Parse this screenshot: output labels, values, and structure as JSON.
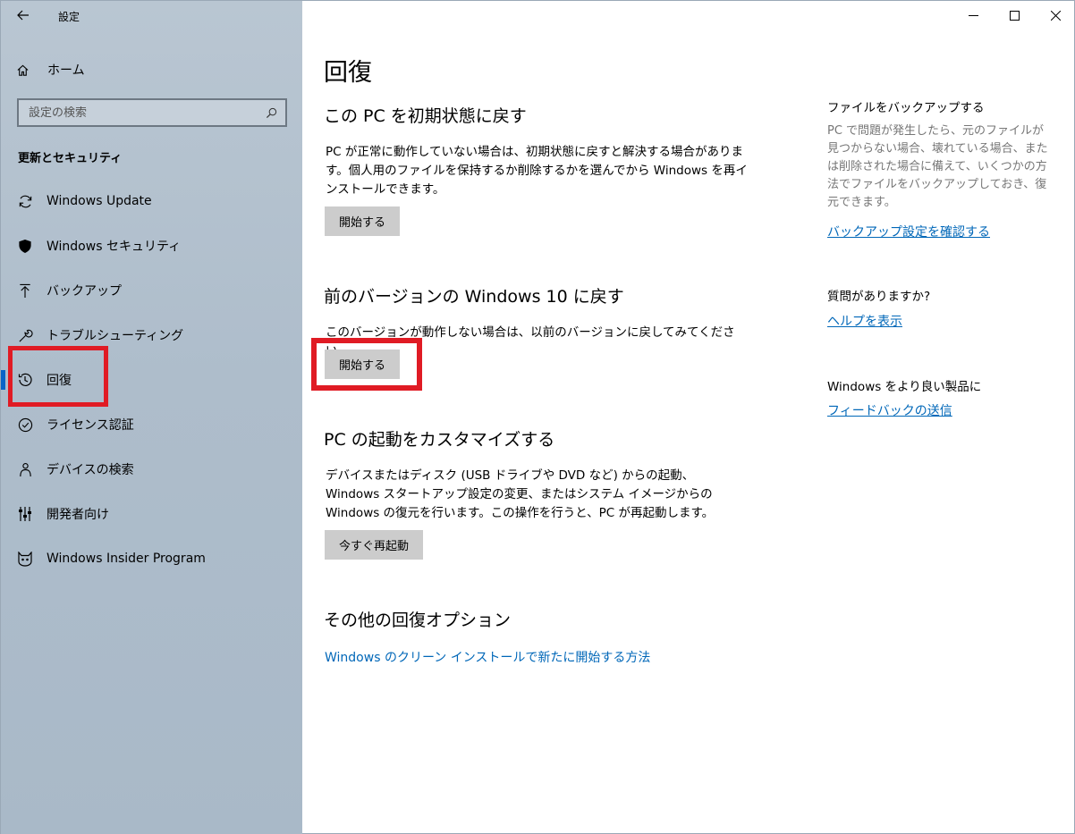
{
  "window": {
    "title": "設定"
  },
  "sidebar": {
    "home_label": "ホーム",
    "search_placeholder": "設定の検索",
    "section_heading": "更新とセキュリティ",
    "items": [
      {
        "label": "Windows Update",
        "icon": "sync-icon"
      },
      {
        "label": "Windows セキュリティ",
        "icon": "shield-icon"
      },
      {
        "label": "バックアップ",
        "icon": "upload-arrow-icon"
      },
      {
        "label": "トラブルシューティング",
        "icon": "wrench-icon"
      },
      {
        "label": "回復",
        "icon": "history-icon",
        "selected": true
      },
      {
        "label": "ライセンス認証",
        "icon": "check-circle-icon"
      },
      {
        "label": "デバイスの検索",
        "icon": "person-location-icon"
      },
      {
        "label": "開発者向け",
        "icon": "developer-sliders-icon"
      },
      {
        "label": "Windows Insider Program",
        "icon": "insider-cat-icon"
      }
    ]
  },
  "main": {
    "title": "回復",
    "reset": {
      "heading": "この PC を初期状態に戻す",
      "body": "PC が正常に動作していない場合は、初期状態に戻すと解決する場合があります。個人用のファイルを保持するか削除するかを選んでから Windows を再インストールできます。",
      "button": "開始する"
    },
    "go_back": {
      "heading": "前のバージョンの Windows 10 に戻す",
      "body": "このバージョンが動作しない場合は、以前のバージョンに戻してみてください。",
      "button": "開始する"
    },
    "advanced_startup": {
      "heading": "PC の起動をカスタマイズする",
      "body": "デバイスまたはディスク (USB ドライブや DVD など) からの起動、Windows スタートアップ設定の変更、またはシステム イメージからの Windows の復元を行います。この操作を行うと、PC が再起動します。",
      "button": "今すぐ再起動"
    },
    "more_options": {
      "heading": "その他の回復オプション",
      "link": "Windows のクリーン インストールで新たに開始する方法"
    }
  },
  "right_column": {
    "backup": {
      "title": "ファイルをバックアップする",
      "text": "PC で問題が発生したら、元のファイルが見つからない場合、壊れている場合、または削除された場合に備えて、いくつかの方法でファイルをバックアップしておき、復元できます。",
      "link": "バックアップ設定を確認する"
    },
    "help": {
      "title": "質問がありますか?",
      "link": "ヘルプを表示"
    },
    "feedback": {
      "title": "Windows をより良い製品に",
      "link": "フィードバックの送信"
    }
  },
  "colors": {
    "accent": "#0067b8",
    "highlight": "#e01b24",
    "button_bg": "#cccccc"
  }
}
